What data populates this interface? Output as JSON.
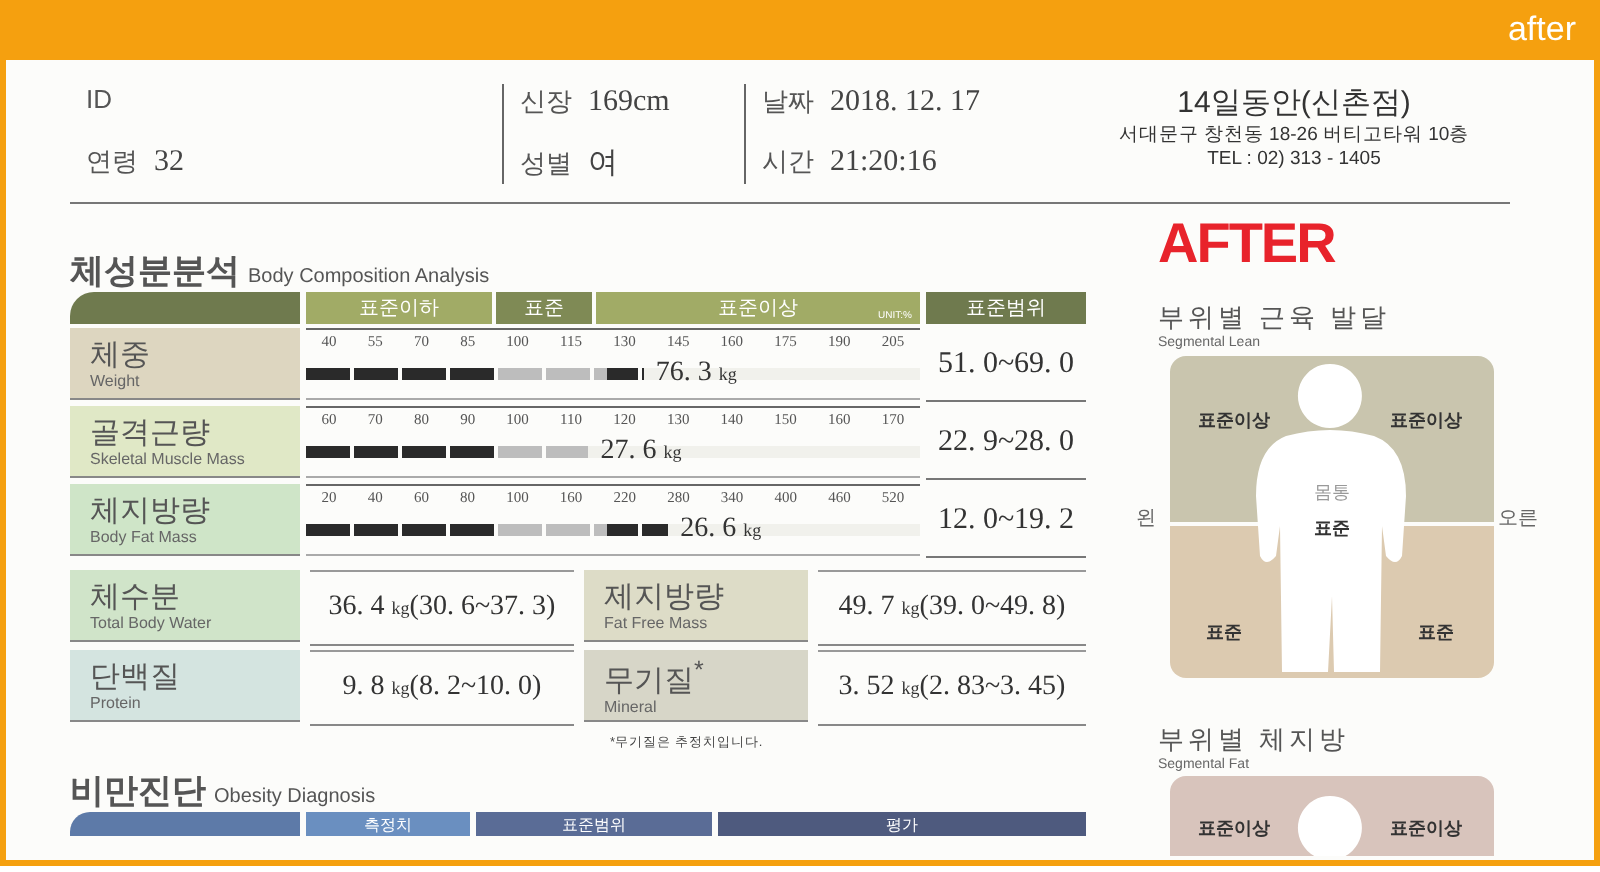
{
  "badge": "after",
  "info": [
    [
      {
        "label": "ID"
      },
      {
        "label": "연령",
        "value": "32"
      }
    ],
    [
      {
        "label": "신장",
        "value": "169cm"
      },
      {
        "label": "성별",
        "value": "여"
      }
    ],
    [
      {
        "label": "날짜",
        "value": "2018. 12. 17"
      },
      {
        "label": "시간",
        "value": "21:20:16"
      }
    ]
  ],
  "store": {
    "name": "14일동안(신촌점)",
    "address": "서대문구 창천동 18-26 버티고타워 10층",
    "phone": "TEL : 02) 313 - 1405"
  },
  "stamp": "AFTER",
  "body_composition": {
    "title": "체성분분석",
    "subtitle": "Body Composition Analysis",
    "zones": [
      "표준이하",
      "표준",
      "표준이상"
    ],
    "unit": "UNIT:%",
    "range_header": "표준범위",
    "rows": [
      {
        "name": "체중",
        "english": "Weight",
        "color": "#ddd6c0",
        "ticks": [
          "40",
          "55",
          "70",
          "85",
          "100",
          "115",
          "130",
          "145",
          "160",
          "175",
          "190",
          "205"
        ],
        "level": 0.55,
        "value": "76. 3",
        "unit": "kg",
        "range": "51. 0~69. 0"
      },
      {
        "name": "골격근량",
        "english": "Skeletal Muscle Mass",
        "color": "#e0e8c6",
        "ticks": [
          "60",
          "70",
          "80",
          "90",
          "100",
          "110",
          "120",
          "130",
          "140",
          "150",
          "160",
          "170"
        ],
        "level": 0.46,
        "value": "27. 6",
        "unit": "kg",
        "range": "22. 9~28. 0"
      },
      {
        "name": "체지방량",
        "english": "Body Fat Mass",
        "color": "#cfe5c8",
        "ticks": [
          "20",
          "40",
          "60",
          "80",
          "100",
          "160",
          "220",
          "280",
          "340",
          "400",
          "460",
          "520"
        ],
        "level": 0.59,
        "value": "26. 6",
        "unit": "kg",
        "range": "12. 0~19. 2"
      }
    ]
  },
  "details": [
    {
      "name": "체수분",
      "english": "Total Body Water",
      "color": "#d0e4c9",
      "value": "36. 4",
      "unit": "kg",
      "range": "(30. 6~37. 3)"
    },
    {
      "name": "제지방량",
      "english": "Fat Free Mass",
      "color": "#dddcc7",
      "value": "49. 7",
      "unit": "kg",
      "range": "(39. 0~49. 8)"
    },
    {
      "name": "단백질",
      "english": "Protein",
      "color": "#d4e4e0",
      "value": "9. 8",
      "unit": "kg",
      "range": "(8. 2~10. 0)"
    },
    {
      "name": "무기질$^{*}$",
      "english": "Mineral",
      "color": "#d7d6c8",
      "value": "3. 52",
      "unit": "kg",
      "range": "(2. 83~3. 45)"
    }
  ],
  "footnote": "*무기질은 추정치입니다.",
  "obesity": {
    "title": "비만진단",
    "subtitle": "Obesity Diagnosis",
    "columns": [
      "측정치",
      "표준범위",
      "평가"
    ]
  },
  "segmental_lean": {
    "title": "부위별 근육 발달",
    "subtitle": "Segmental Lean",
    "left_side": "왼",
    "right_side": "오른",
    "left_arm": "표준이상",
    "right_arm": "표준이상",
    "trunk_label": "몸통",
    "trunk": "표준",
    "left_leg": "표준",
    "right_leg": "표준"
  },
  "segmental_fat": {
    "title": "부위별 체지방",
    "subtitle": "Segmental Fat",
    "left_arm": "표준이상",
    "right_arm": "표준이상"
  }
}
